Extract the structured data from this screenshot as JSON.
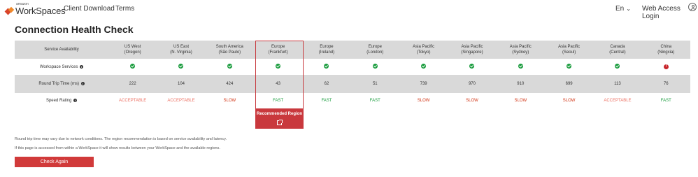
{
  "header": {
    "logo_amazon": "amazon",
    "logo_name": "WorkSpaces",
    "nav": [
      "Client Download",
      "Terms"
    ],
    "language": "En",
    "login": "Web Access Login"
  },
  "title": "Connection Health Check",
  "table": {
    "header_label": "Service Availability",
    "regions": [
      {
        "line1": "US West",
        "line2": "(Oregon)"
      },
      {
        "line1": "US East",
        "line2": "(N. Virginia)"
      },
      {
        "line1": "South America",
        "line2": "(São Paulo)"
      },
      {
        "line1": "Europe",
        "line2": "(Frankfurt)"
      },
      {
        "line1": "Europe",
        "line2": "(Ireland)"
      },
      {
        "line1": "Europe",
        "line2": "(London)"
      },
      {
        "line1": "Asia Pacific",
        "line2": "(Tokyo)"
      },
      {
        "line1": "Asia Pacific",
        "line2": "(Singapore)"
      },
      {
        "line1": "Asia Pacific",
        "line2": "(Sydney)"
      },
      {
        "line1": "Asia Pacific",
        "line2": "(Seoul)"
      },
      {
        "line1": "Canada",
        "line2": "(Central)"
      },
      {
        "line1": "China",
        "line2": "(Ningxia)"
      }
    ],
    "row_labels": {
      "services": "Workspace Services",
      "rtt": "Round Trip Time (ms)",
      "speed": "Speed Rating"
    },
    "services": [
      "ok",
      "ok",
      "ok",
      "ok",
      "ok",
      "ok",
      "ok",
      "ok",
      "ok",
      "ok",
      "ok",
      "error"
    ],
    "rtt": [
      "222",
      "104",
      "424",
      "43",
      "62",
      "51",
      "739",
      "970",
      "910",
      "699",
      "113",
      "76"
    ],
    "speed": [
      "ACCEPTABLE",
      "ACCEPTABLE",
      "SLOW",
      "FAST",
      "FAST",
      "FAST",
      "SLOW",
      "SLOW",
      "SLOW",
      "SLOW",
      "ACCEPTABLE",
      "FAST"
    ]
  },
  "recommended": {
    "label": "Recommended Region",
    "region_index": 3
  },
  "notes": [
    "Round trip time may vary due to network conditions. The region recommendation is based on service availability and latency.",
    "If this page is accessed from within a WorkSpace it will show results between your WorkSpace and the available regions."
  ],
  "check_again": "Check Again",
  "colors": {
    "accent": "#d13a3a",
    "ok": "#1a9c3e",
    "error": "#c7252b",
    "fast": "#1a9c3e",
    "slow": "#d13212",
    "acceptable": "#ec7063"
  }
}
